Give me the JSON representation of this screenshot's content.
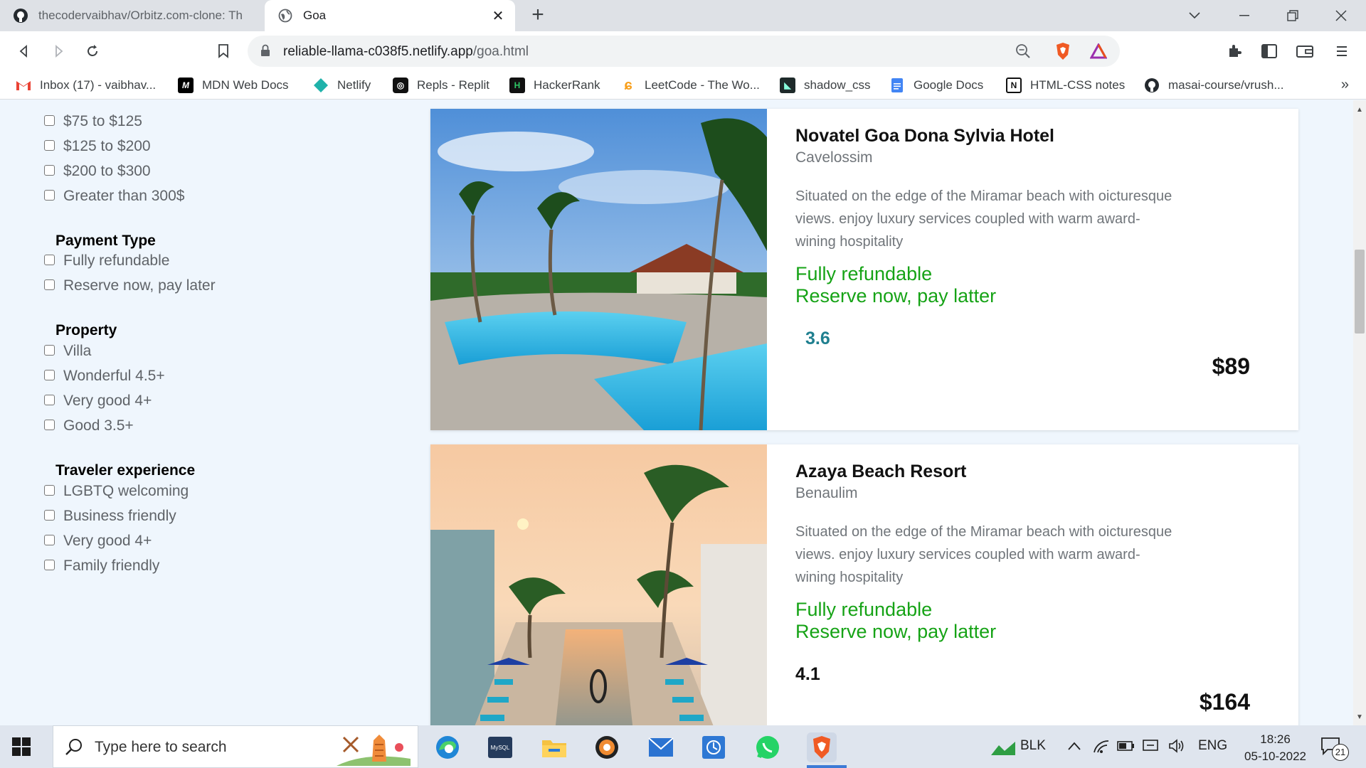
{
  "browser": {
    "tabs": [
      {
        "title": "thecodervaibhav/Orbitz.com-clone: Th",
        "active": false,
        "icon": "github-icon"
      },
      {
        "title": "Goa",
        "active": true,
        "icon": "globe-icon"
      }
    ],
    "url_host": "reliable-llama-c038f5.netlify.app",
    "url_path": "/goa.html",
    "bookmarks": [
      {
        "label": "Inbox (17) - vaibhav...",
        "icon": "gmail-icon"
      },
      {
        "label": "MDN Web Docs",
        "icon": "mdn-icon"
      },
      {
        "label": "Netlify",
        "icon": "netlify-icon"
      },
      {
        "label": "Repls - Replit",
        "icon": "replit-icon"
      },
      {
        "label": "HackerRank",
        "icon": "hackerrank-icon"
      },
      {
        "label": "LeetCode - The Wo...",
        "icon": "leetcode-icon"
      },
      {
        "label": "shadow_css",
        "icon": "shadow-css-icon"
      },
      {
        "label": "Google Docs",
        "icon": "google-docs-icon"
      },
      {
        "label": "HTML-CSS notes",
        "icon": "notion-icon"
      },
      {
        "label": "masai-course/vrush...",
        "icon": "github-icon"
      }
    ],
    "bookmarks_more": "»"
  },
  "filters": {
    "price": [
      "$75 to $125",
      "$125 to $200",
      "$200 to $300",
      "Greater than 300$"
    ],
    "payment": {
      "title": "Payment Type",
      "options": [
        "Fully refundable",
        "Reserve now, pay later"
      ]
    },
    "property": {
      "title": "Property",
      "options": [
        "Villa",
        "Wonderful 4.5+",
        "Very good 4+",
        "Good 3.5+"
      ]
    },
    "traveler": {
      "title": "Traveler experience",
      "options": [
        "LGBTQ welcoming",
        "Business friendly",
        "Very good 4+",
        "Family friendly"
      ]
    }
  },
  "hotels": [
    {
      "name": "Novatel Goa Dona Sylvia Hotel",
      "location": "Cavelossim",
      "description": "Situated on the edge of the Miramar beach with oicturesque views. enjoy luxury services coupled with warm award-wining hospitality",
      "pay1": "Fully refundable",
      "pay2": "Reserve now, pay latter",
      "rating": "3.6",
      "rating_color": "#1f7f8f",
      "price": "$89"
    },
    {
      "name": "Azaya Beach Resort",
      "location": "Benaulim",
      "description": "Situated on the edge of the Miramar beach with oicturesque views. enjoy luxury services coupled with warm award-wining hospitality",
      "pay1": "Fully refundable",
      "pay2": "Reserve now, pay latter",
      "rating": "4.1",
      "rating_color": "#111111",
      "price": "$164"
    }
  ],
  "taskbar": {
    "search_placeholder": "Type here to search",
    "stock_label": "BLK",
    "language": "ENG",
    "time": "18:26",
    "date": "05-10-2022",
    "notifications": "21"
  }
}
